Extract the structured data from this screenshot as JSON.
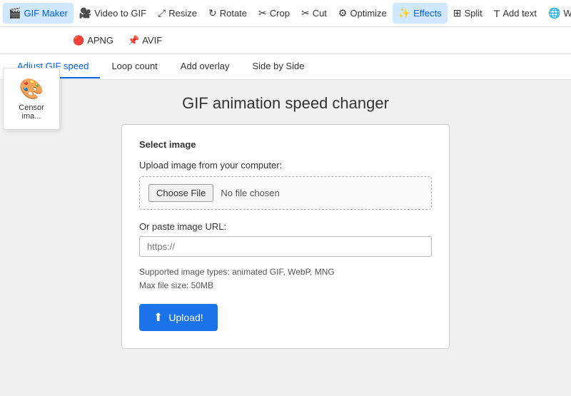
{
  "topNav": {
    "items": [
      {
        "label": "GIF Maker",
        "icon": "🎬",
        "active": false
      },
      {
        "label": "Video to GIF",
        "icon": "🎥",
        "active": false
      },
      {
        "label": "Resize",
        "icon": "⤢",
        "active": false
      },
      {
        "label": "Rotate",
        "icon": "↻",
        "active": false
      },
      {
        "label": "Crop",
        "icon": "✂",
        "active": false
      },
      {
        "label": "Cut",
        "icon": "✂",
        "active": false
      },
      {
        "label": "Optimize",
        "icon": "⚙",
        "active": false
      },
      {
        "label": "Effects",
        "icon": "✨",
        "active": true
      },
      {
        "label": "Split",
        "icon": "⊞",
        "active": false
      },
      {
        "label": "Add text",
        "icon": "T",
        "active": false
      },
      {
        "label": "WebP",
        "icon": "🌐",
        "active": false
      }
    ]
  },
  "secondNav": {
    "items": [
      {
        "label": "APNG",
        "icon": "🔴"
      },
      {
        "label": "AVIF",
        "icon": "📌"
      }
    ]
  },
  "censorPanel": {
    "icon": "🎨",
    "label": "Censor ima..."
  },
  "subTabs": {
    "items": [
      {
        "label": "Adjust GIF speed",
        "active": true
      },
      {
        "label": "Loop count",
        "active": false
      },
      {
        "label": "Add overlay",
        "active": false
      },
      {
        "label": "Side by Side",
        "active": false
      }
    ]
  },
  "main": {
    "title": "GIF animation speed changer",
    "card": {
      "sectionTitle": "Select image",
      "uploadLabel": "Upload image from your computer:",
      "chooseFileBtn": "Choose File",
      "noFileText": "No file chosen",
      "urlLabel": "Or paste image URL:",
      "urlPlaceholder": "https://",
      "supportedLine1": "Supported image types: animated GIF, WebP, MNG",
      "supportedLine2": "Max file size: 50MB",
      "uploadBtn": "Upload!"
    }
  }
}
